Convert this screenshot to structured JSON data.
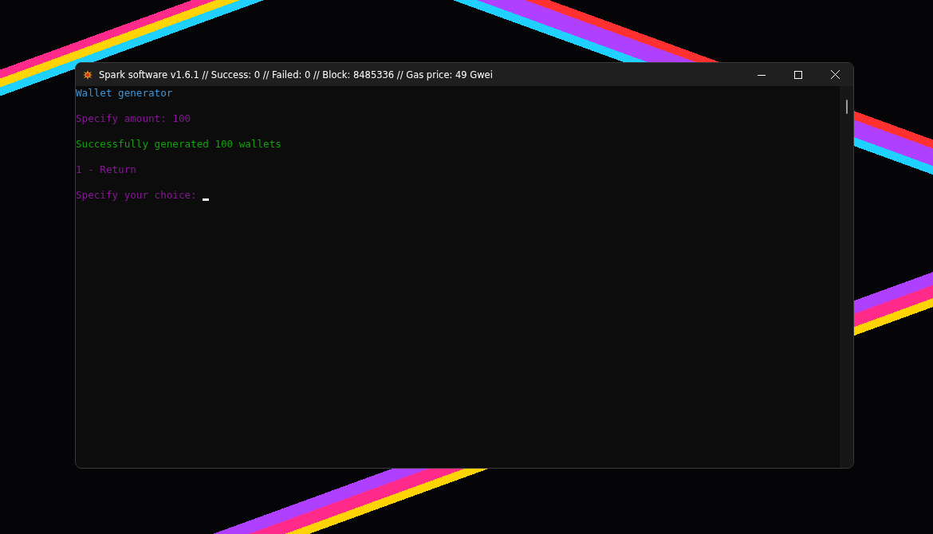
{
  "window": {
    "title": "Spark software v1.6.1 // Success: 0 // Failed: 0 // Block: 8485336 // Gas price: 49 Gwei"
  },
  "console": {
    "lines": [
      {
        "kind": "heading",
        "text": "Wallet generator",
        "cursor": false
      },
      {
        "kind": "prompt",
        "text": "Specify amount: 100",
        "cursor": false
      },
      {
        "kind": "success",
        "text": "Successfully generated 100 wallets",
        "cursor": false
      },
      {
        "kind": "prompt",
        "text": "1 - Return",
        "cursor": false
      },
      {
        "kind": "prompt",
        "text": "Specify your choice: ",
        "cursor": true
      }
    ]
  }
}
